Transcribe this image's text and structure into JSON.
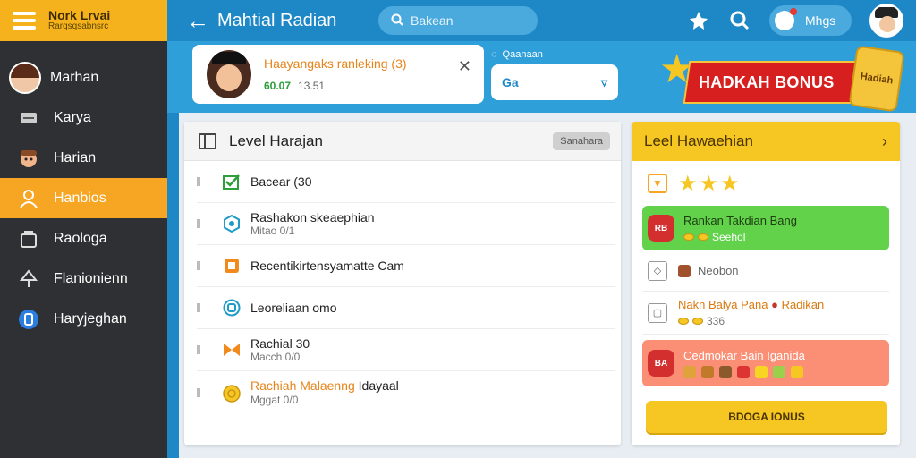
{
  "sidebar": {
    "brand_title": "Nork Lrvai",
    "brand_subtitle": "Rarqsqsabnsrc",
    "items": [
      {
        "label": "Marhan",
        "icon": "avatar"
      },
      {
        "label": "Karya",
        "icon": "card-icon"
      },
      {
        "label": "Harian",
        "icon": "character-icon"
      },
      {
        "label": "Hanbios",
        "icon": "user-outline-icon",
        "active": true
      },
      {
        "label": "Raologa",
        "icon": "bag-icon"
      },
      {
        "label": "Flanionienn",
        "icon": "tree-icon"
      },
      {
        "label": "Haryjeghan",
        "icon": "blue-badge-icon"
      }
    ]
  },
  "topbar": {
    "title": "Mahtial Radian",
    "search_placeholder": "Bakean",
    "user_chip_label": "Mhgs"
  },
  "banner": {
    "player_title": "Haayangaks ranleking (3)",
    "player_points": "60.07",
    "player_meta": "13.51",
    "code_label": "Qaanaan",
    "code_value": "Ga",
    "bonus_text": "HADKAH BONUS",
    "chest_label": "Hadiah"
  },
  "levels": {
    "title": "Level Harajan",
    "header_button": "Sanahara",
    "tasks": [
      {
        "label": "Bacear (30",
        "sub": "",
        "icon": "check-icon",
        "highlight": false
      },
      {
        "label": "Rashakon skeaephian",
        "sub": "Mitao 0/1",
        "icon": "hexagon-icon",
        "highlight": false
      },
      {
        "label": "Recentikirtensyamatte Cam",
        "sub": "",
        "icon": "puzzle-icon",
        "highlight": false
      },
      {
        "label": "Leoreliaan omo",
        "sub": "",
        "icon": "circle-icon",
        "highlight": false
      },
      {
        "label": "Rachial 30",
        "sub": "Macch 0/0",
        "icon": "bow-icon",
        "highlight": false
      },
      {
        "label": "Rachiah Malaenng",
        "label2": "Idayaal",
        "sub": "Mggat 0/0",
        "icon": "coin-icon",
        "highlight": true
      }
    ]
  },
  "rewards": {
    "title": "Leel Hawaehian",
    "item_green_title": "Rankan Takdian Bang",
    "item_green_sub": "Seehol",
    "item_badge": "RB",
    "item_plain_label": "Neobon",
    "item_orange_title": "Nakn Balya Pana",
    "item_orange_title2": "Radikan",
    "item_orange_sub": "336",
    "item_salmon_title": "Cedmokar Bain Iganida",
    "item_salmon_badge": "BA",
    "claim_button": "BDOGA IONUS"
  },
  "colors": {
    "sidebar_bg": "#2f3033",
    "brand_yellow": "#f6b21c",
    "topbar_blue": "#1e88c7",
    "green": "#62d24b",
    "salmon": "#fa8f76"
  }
}
